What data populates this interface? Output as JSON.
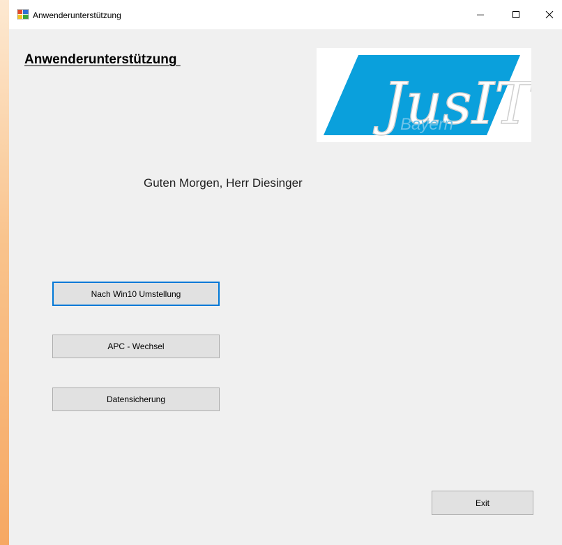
{
  "window": {
    "title": "Anwenderunterstützung",
    "controls": {
      "minimize": "minimize-icon",
      "maximize": "maximize-icon",
      "close": "close-icon"
    }
  },
  "main": {
    "heading": "Anwenderunterstützung ",
    "greeting": "Guten Morgen, Herr Diesinger",
    "logo": {
      "text_main": "JusIT",
      "text_sub": "Bayern",
      "color": "#0aa0dc"
    }
  },
  "buttons": {
    "win10": "Nach Win10 Umstellung",
    "apc": "APC - Wechsel",
    "datensicherung": "Datensicherung",
    "exit": "Exit"
  },
  "colors": {
    "window_bg": "#f0f0f0",
    "button_bg": "#e1e1e1",
    "button_border": "#adadad",
    "focus_border": "#0078d7"
  }
}
